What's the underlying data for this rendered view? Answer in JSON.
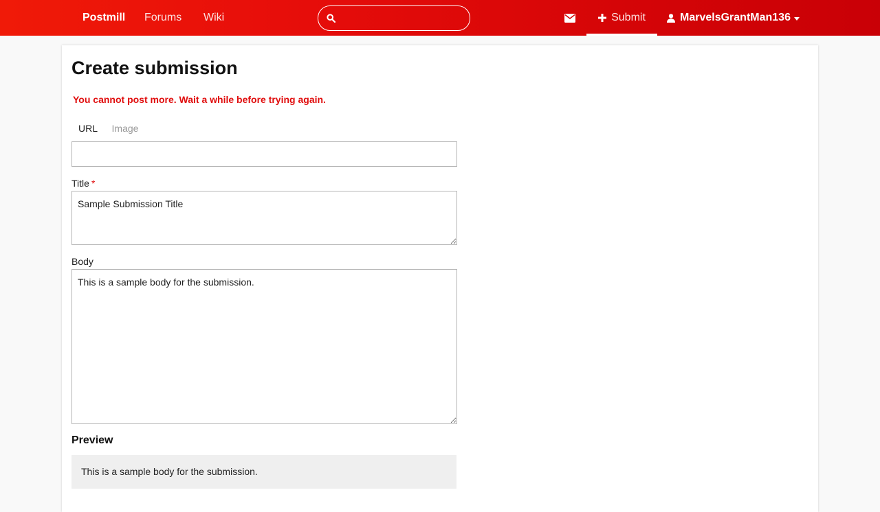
{
  "nav": {
    "brand": "Postmill",
    "forums": "Forums",
    "wiki": "Wiki",
    "search_value": "",
    "submit": "Submit",
    "user": "MarvelsGrantMan136"
  },
  "page": {
    "title": "Create submission",
    "error": "You cannot post more. Wait a while before trying again."
  },
  "tabs": {
    "url": "URL",
    "image": "Image",
    "active": "URL"
  },
  "form": {
    "url_value": "",
    "title_label": "Title",
    "title_required_mark": "*",
    "title_value": "Sample Submission Title",
    "body_label": "Body",
    "body_value": "This is a sample body for the submission."
  },
  "preview": {
    "heading": "Preview",
    "text": "This is a sample body for the submission."
  },
  "colors": {
    "brand_red": "#e60d0a",
    "error_red": "#e00d0d",
    "preview_bg": "#efefef"
  },
  "icons": {
    "search": "search-icon",
    "messages": "envelope-icon",
    "submit": "plus-icon",
    "user": "user-icon",
    "dropdown": "caret-down-icon"
  }
}
